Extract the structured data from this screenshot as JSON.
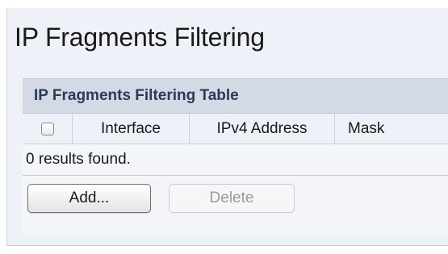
{
  "page": {
    "title": "IP Fragments Filtering"
  },
  "table": {
    "title": "IP Fragments Filtering Table",
    "columns": [
      "Interface",
      "IPv4 Address",
      "Mask"
    ],
    "select_all_checked": false,
    "results_text": "0 results found."
  },
  "buttons": {
    "add_label": "Add...",
    "delete_label": "Delete",
    "delete_enabled": false
  },
  "colors": {
    "panel_bg": "#eef1f7",
    "header_bg": "#d4dae5",
    "header_text": "#2b3a55",
    "disabled_text": "#9b9b9b"
  }
}
